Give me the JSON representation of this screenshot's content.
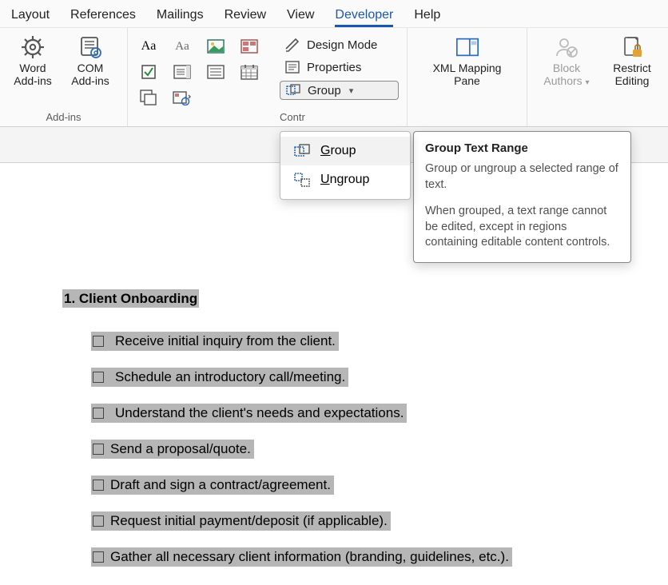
{
  "tabs": {
    "layout": "Layout",
    "references": "References",
    "mailings": "Mailings",
    "review": "Review",
    "view": "View",
    "developer": "Developer",
    "help": "Help",
    "active": "developer"
  },
  "ribbon": {
    "addins": {
      "word_addins_l1": "Word",
      "word_addins_l2": "Add-ins",
      "com_addins_l1": "COM",
      "com_addins_l2": "Add-ins",
      "label": "Add-ins"
    },
    "controls": {
      "label": "Contr",
      "design_mode": "Design Mode",
      "properties": "Properties",
      "group": "Group"
    },
    "mapping": {
      "l1": "XML Mapping",
      "l2": "Pane"
    },
    "block_authors_l1": "Block",
    "block_authors_l2": "Authors",
    "restrict_l1": "Restrict",
    "restrict_l2": "Editing"
  },
  "dropdown": {
    "group": "Group",
    "ungroup": "Ungroup"
  },
  "tooltip": {
    "title": "Group Text Range",
    "p1": "Group or ungroup a selected range of text.",
    "p2": "When grouped, a text range cannot be edited, except in regions containing editable content controls."
  },
  "document": {
    "heading": "1. Client Onboarding",
    "items": [
      "Receive initial inquiry from the client.",
      "Schedule an introductory call/meeting.",
      "Understand the client's needs and expectations.",
      "Send a proposal/quote.",
      "Draft and sign a contract/agreement.",
      "Request initial payment/deposit (if applicable).",
      "Gather all necessary client information (branding, guidelines, etc.)."
    ]
  }
}
